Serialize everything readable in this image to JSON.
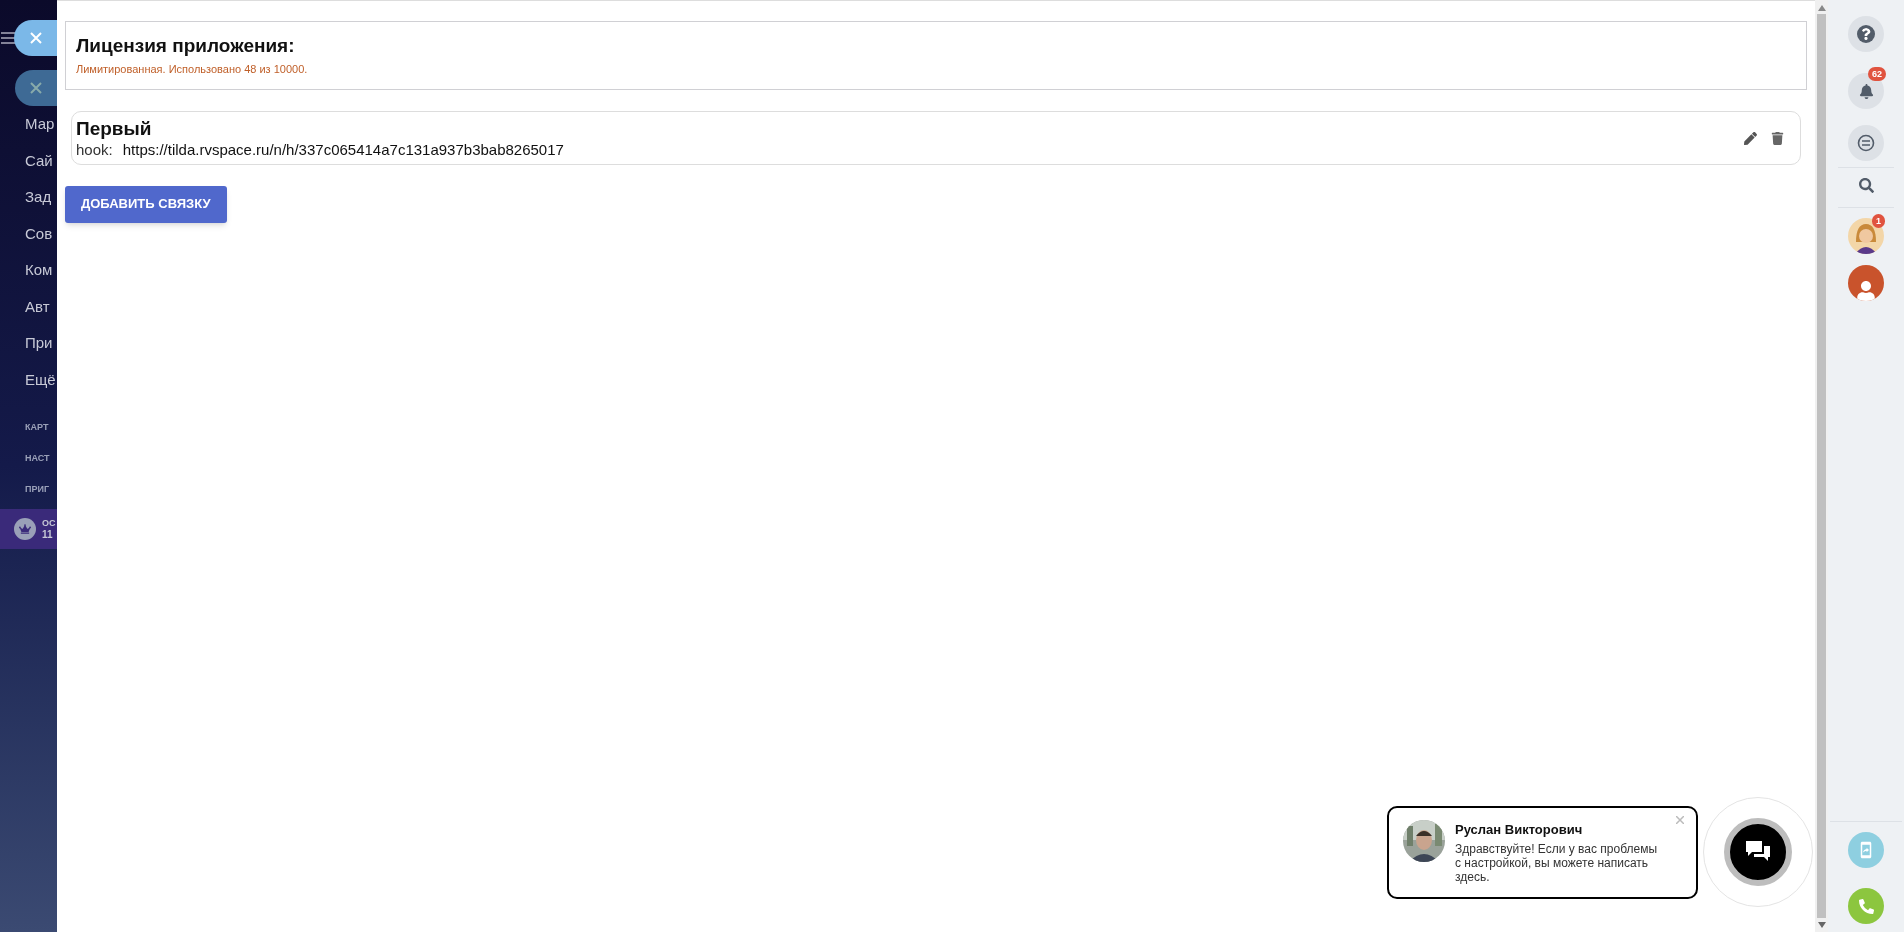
{
  "sidebar": {
    "items": [
      {
        "label": "Мар"
      },
      {
        "label": "Сай"
      },
      {
        "label": "Зад"
      },
      {
        "label": "Сов"
      },
      {
        "label": "Ком"
      },
      {
        "label": "Авт"
      },
      {
        "label": "При"
      },
      {
        "label": "Ещё"
      }
    ],
    "sections": [
      {
        "label": "КАРТ"
      },
      {
        "label": "НАСТ"
      },
      {
        "label": "ПРИГ"
      }
    ],
    "plan": {
      "line_1": "ОС",
      "line_2": "11"
    }
  },
  "license": {
    "title": "Лицензия приложения:",
    "status": "Лимитированная. Использовано 48 из 10000."
  },
  "connections": [
    {
      "name": "Первый",
      "hook_label": "hook:",
      "hook_url": "https://tilda.rvspace.ru/n/h/337c065414a7c131a937b3bab8265017"
    }
  ],
  "add_button": "ДОБАВИТЬ СВЯЗКУ",
  "right_bar": {
    "notifications_badge": "62",
    "avatar_badge": "1"
  },
  "chat": {
    "name": "Руслан Викторович",
    "message": "Здравствуйте! Если у вас проблемы с настройкой, вы можете написать здесь."
  }
}
